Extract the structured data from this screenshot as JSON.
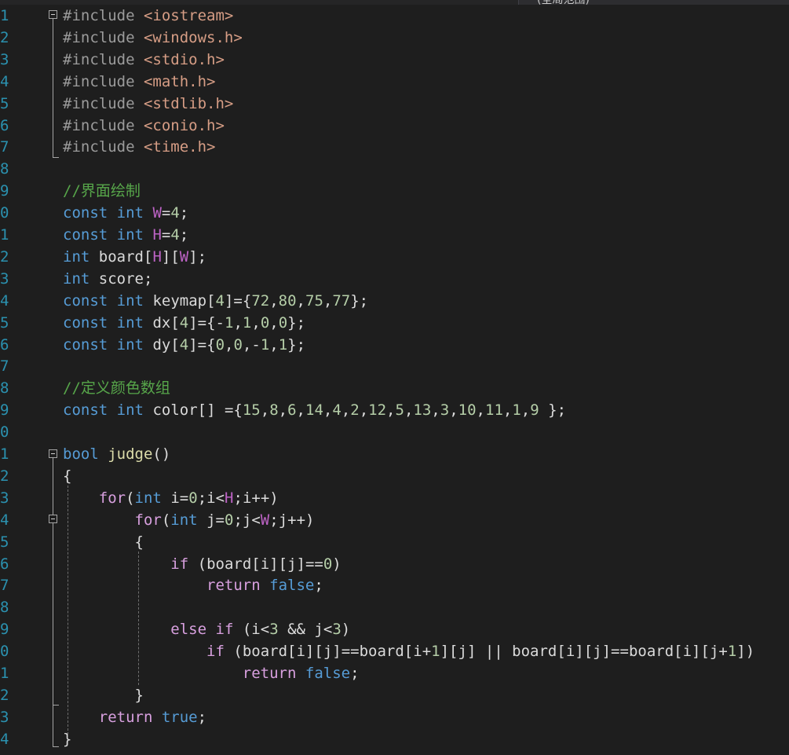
{
  "editor": {
    "tab_fragment": "(全局范围)",
    "lines": [
      {
        "n": "1",
        "code": "#include <iostream>",
        "fold": true
      },
      {
        "n": "2",
        "code": "#include <windows.h>"
      },
      {
        "n": "3",
        "code": "#include <stdio.h>"
      },
      {
        "n": "4",
        "code": "#include <math.h>"
      },
      {
        "n": "5",
        "code": "#include <stdlib.h>"
      },
      {
        "n": "6",
        "code": "#include <conio.h>"
      },
      {
        "n": "7",
        "code": "#include <time.h>"
      },
      {
        "n": "8",
        "code": ""
      },
      {
        "n": "9",
        "code": "//界面绘制"
      },
      {
        "n": "0",
        "code": "const int W=4;"
      },
      {
        "n": "1",
        "code": "const int H=4;"
      },
      {
        "n": "2",
        "code": "int board[H][W];"
      },
      {
        "n": "3",
        "code": "int score;"
      },
      {
        "n": "4",
        "code": "const int keymap[4]={72,80,75,77};"
      },
      {
        "n": "5",
        "code": "const int dx[4]={-1,1,0,0};"
      },
      {
        "n": "6",
        "code": "const int dy[4]={0,0,-1,1};"
      },
      {
        "n": "7",
        "code": ""
      },
      {
        "n": "8",
        "code": "//定义颜色数组"
      },
      {
        "n": "9",
        "code": "const int color[] ={15,8,6,14,4,2,12,5,13,3,10,11,1,9 };"
      },
      {
        "n": "0",
        "code": ""
      },
      {
        "n": "1",
        "code": "bool judge()",
        "fold": true
      },
      {
        "n": "2",
        "code": "{"
      },
      {
        "n": "3",
        "code": "    for(int i=0;i<H;i++)"
      },
      {
        "n": "4",
        "code": "        for(int j=0;j<W;j++)",
        "fold": true
      },
      {
        "n": "5",
        "code": "        {"
      },
      {
        "n": "6",
        "code": "            if (board[i][j]==0)"
      },
      {
        "n": "7",
        "code": "                return false;"
      },
      {
        "n": "8",
        "code": ""
      },
      {
        "n": "9",
        "code": "            else if (i<3 && j<3)"
      },
      {
        "n": "0",
        "code": "                if (board[i][j]==board[i+1][j] || board[i][j]==board[i][j+1])"
      },
      {
        "n": "1",
        "code": "                    return false;"
      },
      {
        "n": "2",
        "code": "        }"
      },
      {
        "n": "3",
        "code": "    return true;"
      },
      {
        "n": "4",
        "code": "}"
      }
    ]
  },
  "colors": {
    "background": "#1e1e1e",
    "keyword": "#569cd6",
    "control": "#d8a0df",
    "preprocessor": "#9b9b9b",
    "include_path": "#d69d85",
    "comment": "#57a64a",
    "number": "#b5cea8",
    "function": "#dcdcaa",
    "line_number": "#2b91af"
  }
}
